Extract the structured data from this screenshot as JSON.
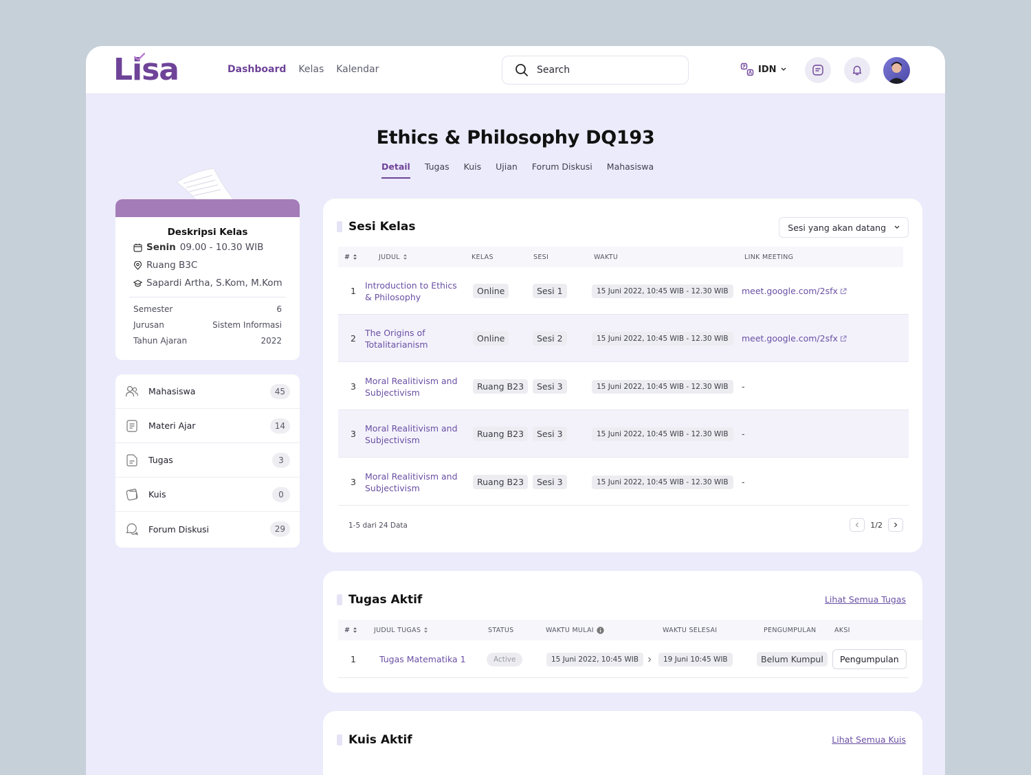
{
  "header": {
    "logo": "Lisa",
    "nav": [
      {
        "label": "Dashboard",
        "active": true
      },
      {
        "label": "Kelas",
        "active": false
      },
      {
        "label": "Kalendar",
        "active": false
      }
    ],
    "search_placeholder": "Search",
    "language": "IDN"
  },
  "course": {
    "title": "Ethics & Philosophy DQ193",
    "tabs": [
      "Detail",
      "Tugas",
      "Kuis",
      "Ujian",
      "Forum Diskusi",
      "Mahasiswa"
    ]
  },
  "description": {
    "title": "Deskripsi Kelas",
    "day": "Senin",
    "time": "09.00 - 10.30 WIB",
    "room": "Ruang B3C",
    "lecturer": "Sapardi Artha, S.Kom, M.Kom",
    "meta": [
      {
        "key": "Semester",
        "value": "6"
      },
      {
        "key": "Jurusan",
        "value": "Sistem Informasi"
      },
      {
        "key": "Tahun Ajaran",
        "value": "2022"
      }
    ]
  },
  "menu": [
    {
      "label": "Mahasiswa",
      "count": "45",
      "icon": "users-icon"
    },
    {
      "label": "Materi Ajar",
      "count": "14",
      "icon": "book-icon"
    },
    {
      "label": "Tugas",
      "count": "3",
      "icon": "assignment-icon"
    },
    {
      "label": "Kuis",
      "count": "0",
      "icon": "quiz-icon"
    },
    {
      "label": "Forum  Diskusi",
      "count": "29",
      "icon": "chat-icon"
    }
  ],
  "sesi": {
    "title": "Sesi Kelas",
    "filter": "Sesi yang akan datang",
    "columns": [
      "#",
      "JUDUL",
      "KELAS",
      "SESI",
      "WAKTU",
      "LINK MEETING"
    ],
    "rows": [
      {
        "no": "1",
        "judul": "Introduction to Ethics & Philosophy",
        "kelas": "Online",
        "sesi": "Sesi 1",
        "waktu": "15 Juni 2022, 10:45 WIB - 12.30 WIB",
        "link": "meet.google.com/2sfx"
      },
      {
        "no": "2",
        "judul": "The Origins of Totalitarianism",
        "kelas": "Online",
        "sesi": "Sesi 2",
        "waktu": "15 Juni 2022, 10:45 WIB - 12.30 WIB",
        "link": "meet.google.com/2sfx"
      },
      {
        "no": "3",
        "judul": "Moral Realitivism and Subjectivism",
        "kelas": "Ruang B23",
        "sesi": "Sesi 3",
        "waktu": "15 Juni 2022, 10:45 WIB - 12.30 WIB",
        "link": "-"
      },
      {
        "no": "3",
        "judul": "Moral Realitivism and Subjectivism",
        "kelas": "Ruang B23",
        "sesi": "Sesi 3",
        "waktu": "15 Juni 2022, 10:45 WIB - 12.30 WIB",
        "link": "-"
      },
      {
        "no": "3",
        "judul": "Moral Realitivism and Subjectivism",
        "kelas": "Ruang B23",
        "sesi": "Sesi 3",
        "waktu": "15 Juni 2022, 10:45 WIB - 12.30 WIB",
        "link": "-"
      }
    ],
    "footer": "1-5 dari 24 Data",
    "page": "1/2"
  },
  "tugas": {
    "title": "Tugas Aktif",
    "see_all": "Lihat Semua Tugas",
    "columns": [
      "#",
      "JUDUL TUGAS",
      "STATUS",
      "WAKTU MULAI",
      "WAKTU SELESAI",
      "PENGUMPULAN",
      "AKSI"
    ],
    "rows": [
      {
        "no": "1",
        "judul": "Tugas Matematika 1",
        "status": "Active",
        "mulai": "15 Juni 2022, 10:45 WIB",
        "selesai": "19 Juni 10:45 WIB",
        "pengumpulan": "Belum Kumpul",
        "aksi": "Pengumpulan"
      }
    ]
  },
  "kuis": {
    "title": "Kuis Aktif",
    "see_all": "Lihat Semua Kuis"
  }
}
